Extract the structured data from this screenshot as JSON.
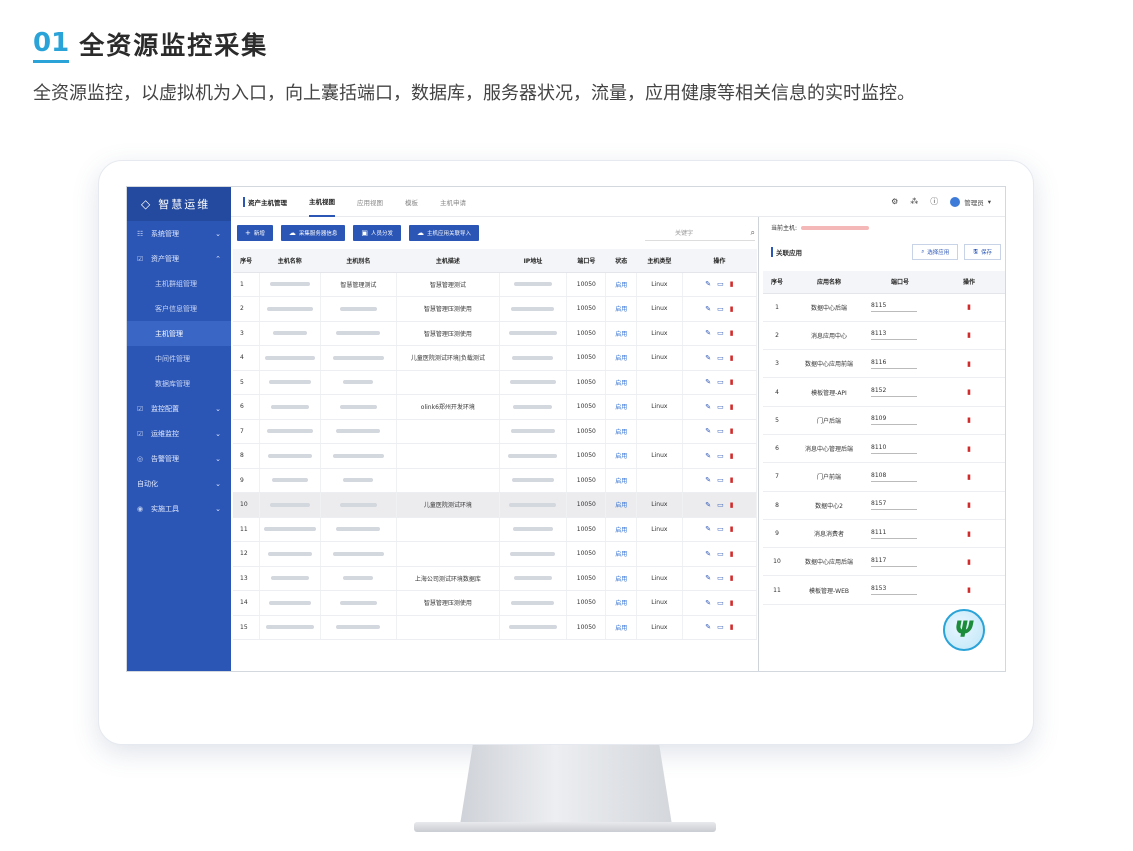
{
  "heading": {
    "number": "01",
    "title": "全资源监控采集"
  },
  "description": "全资源监控，以虚拟机为入口，向上囊括端口，数据库，服务器状况，流量，应用健康等相关信息的实时监控。",
  "app": {
    "logo_text": "智慧运维",
    "sidebar": {
      "items": [
        {
          "icon": "☷",
          "label": "系统管理",
          "chevron": "⌄"
        },
        {
          "icon": "☑",
          "label": "资产管理",
          "chevron": "⌃"
        },
        {
          "label": "主机群组管理"
        },
        {
          "label": "客户信息管理"
        },
        {
          "label": "主机管理"
        },
        {
          "label": "中间件管理"
        },
        {
          "label": "数据库管理"
        },
        {
          "icon": "☑",
          "label": "监控配置",
          "chevron": "⌄"
        },
        {
          "icon": "☑",
          "label": "运维监控",
          "chevron": "⌄"
        },
        {
          "icon": "◎",
          "label": "告警管理",
          "chevron": "⌄"
        },
        {
          "label": "自动化",
          "chevron": "⌄"
        },
        {
          "icon": "◉",
          "label": "实施工具",
          "chevron": "⌄"
        }
      ]
    },
    "topbar": {
      "breadcrumb": "资产主机管理",
      "tabs": [
        "主机视图",
        "应用视图",
        "模板",
        "主机申请"
      ],
      "user_label": "管理员"
    },
    "toolbar": {
      "add": "新增",
      "collect": "采集服务器信息",
      "assign": "人员分发",
      "import": "主机应用关联导入",
      "keyword_placeholder": "关键字"
    },
    "table": {
      "headers": [
        "序号",
        "主机名称",
        "主机别名",
        "主机描述",
        "IP地址",
        "端口号",
        "状态",
        "主机类型",
        "操作"
      ],
      "rows": [
        {
          "no": "1",
          "alias": "智慧管理测试",
          "desc": "智慧管理测试",
          "port": "10050",
          "status": "启用",
          "type": "Linux"
        },
        {
          "no": "2",
          "alias": "",
          "desc": "智慧管理压测使用",
          "port": "10050",
          "status": "启用",
          "type": "Linux"
        },
        {
          "no": "3",
          "alias": "",
          "desc": "智慧管理压测使用",
          "port": "10050",
          "status": "启用",
          "type": "Linux"
        },
        {
          "no": "4",
          "alias": "",
          "desc": "儿童医院测试环境|负载测试",
          "port": "10050",
          "status": "启用",
          "type": "Linux"
        },
        {
          "no": "5",
          "alias": "",
          "desc": "",
          "port": "10050",
          "status": "启用",
          "type": ""
        },
        {
          "no": "6",
          "alias": "",
          "desc": "olink6郑州开发环境",
          "port": "10050",
          "status": "启用",
          "type": "Linux"
        },
        {
          "no": "7",
          "alias": "",
          "desc": "",
          "port": "10050",
          "status": "启用",
          "type": ""
        },
        {
          "no": "8",
          "alias": "",
          "desc": "",
          "port": "10050",
          "status": "启用",
          "type": "Linux"
        },
        {
          "no": "9",
          "alias": "",
          "desc": "",
          "port": "10050",
          "status": "启用",
          "type": ""
        },
        {
          "no": "10",
          "alias": "",
          "desc": "儿童医院测试环境",
          "port": "10050",
          "status": "启用",
          "type": "Linux"
        },
        {
          "no": "11",
          "alias": "",
          "desc": "",
          "port": "10050",
          "status": "启用",
          "type": "Linux"
        },
        {
          "no": "12",
          "alias": "",
          "desc": "",
          "port": "10050",
          "status": "启用",
          "type": ""
        },
        {
          "no": "13",
          "alias": "",
          "desc": "上海公司测试环境数据库",
          "port": "10050",
          "status": "启用",
          "type": "Linux"
        },
        {
          "no": "14",
          "alias": "",
          "desc": "智慧管理压测使用",
          "port": "10050",
          "status": "启用",
          "type": "Linux"
        },
        {
          "no": "15",
          "alias": "",
          "desc": "",
          "port": "10050",
          "status": "启用",
          "type": "Linux"
        }
      ]
    },
    "right_panel": {
      "current_host_label": "当前主机:",
      "section_title": "关联应用",
      "select_app": "选择应用",
      "save": "保存",
      "headers": [
        "序号",
        "应用名称",
        "端口号",
        "操作"
      ],
      "rows": [
        {
          "no": "1",
          "name": "数据中心后端",
          "port": "8115"
        },
        {
          "no": "2",
          "name": "消息应用中心",
          "port": "8113"
        },
        {
          "no": "3",
          "name": "数据中心应用前端",
          "port": "8116"
        },
        {
          "no": "4",
          "name": "模板管理-API",
          "port": "8152"
        },
        {
          "no": "5",
          "name": "门户后端",
          "port": "8109"
        },
        {
          "no": "6",
          "name": "消息中心管理后端",
          "port": "8110"
        },
        {
          "no": "7",
          "name": "门户前端",
          "port": "8108"
        },
        {
          "no": "8",
          "name": "数据中心2",
          "port": "8157"
        },
        {
          "no": "9",
          "name": "消息消费者",
          "port": "8111"
        },
        {
          "no": "10",
          "name": "数据中心应用后端",
          "port": "8117"
        },
        {
          "no": "11",
          "name": "模板管理-WEB",
          "port": "8153"
        }
      ]
    }
  }
}
